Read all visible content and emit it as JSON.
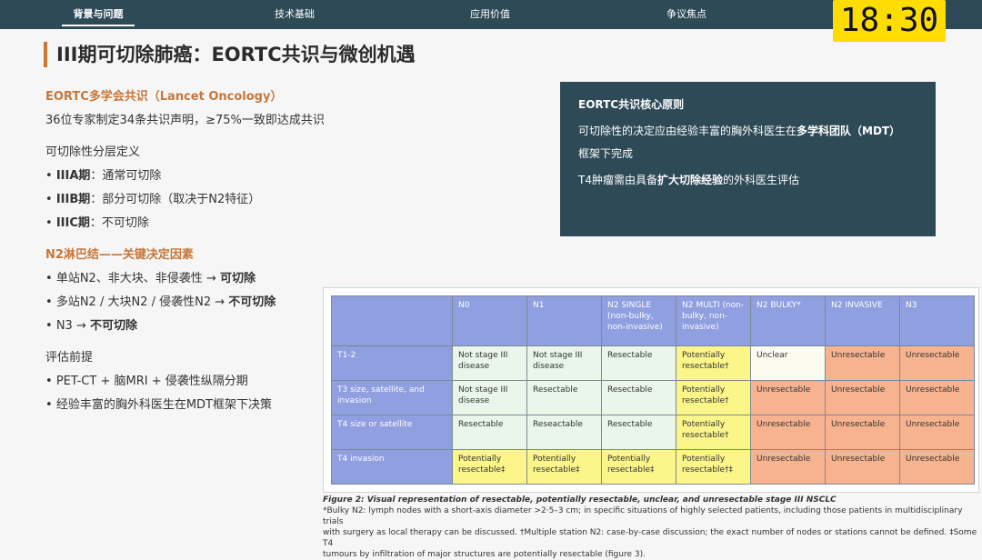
{
  "nav": {
    "tabs": [
      {
        "label": "背景与问题",
        "active": true
      },
      {
        "label": "技术基础"
      },
      {
        "label": "应用价值"
      },
      {
        "label": "争议焦点"
      }
    ]
  },
  "timer": "18:30",
  "slide": {
    "title": "III期可切除肺癌：EORTC共识与微创机遇",
    "eortc_heading": "EORTC多学会共识（Lancet Oncology）",
    "eortc_desc": "36位专家制定34条共识声明，≥75%一致即达成共识",
    "resect_heading": "可切除性分层定义",
    "stages": [
      {
        "label": "IIIA期",
        "desc": "：通常可切除"
      },
      {
        "label": "IIIB期",
        "desc": "：部分可切除（取决于N2特征）"
      },
      {
        "label": "IIIC期",
        "desc": "：不可切除"
      }
    ],
    "n2_heading": "N2淋巴结——关键决定因素",
    "n2_items": [
      {
        "prefix": "单站N2、非大块、非侵袭性 → ",
        "bold": "可切除"
      },
      {
        "prefix": "多站N2 / 大块N2 / 侵袭性N2 → ",
        "bold": "不可切除"
      },
      {
        "prefix": "N3 → ",
        "bold": "不可切除"
      }
    ],
    "eval_heading": "评估前提",
    "eval_items": [
      "PET-CT + 脑MRI + 侵袭性纵隔分期",
      "经验丰富的胸外科医生在MDT框架下决策"
    ]
  },
  "principles": {
    "heading": "EORTC共识核心原则",
    "line1_a": "可切除性的决定应由经验丰富的胸外科医生在",
    "line1_b": "多学科团队（MDT）",
    "line2": "框架下完成",
    "line3_a": "T4肿瘤需由具备",
    "line3_b": "扩大切除经验",
    "line3_c": "的外科医生评估"
  },
  "chart_data": {
    "type": "table",
    "columns": [
      "",
      "N0",
      "N1",
      "N2 SINGLE (non-bulky, non-invasive)",
      "N2 MULTI (non-bulky, non-invasive)",
      "N2 BULKY*",
      "N2 INVASIVE",
      "N3"
    ],
    "rows": [
      {
        "label": "T1-2",
        "cells": [
          "Not stage III disease",
          "Not stage III disease",
          "Resectable",
          "Potentially resectable†",
          "Unclear",
          "Unresectable",
          "Unresectable"
        ]
      },
      {
        "label": "T3 size, satellite, and invasion",
        "cells": [
          "Not stage III disease",
          "Resectable",
          "Resectable",
          "Potentially resectable†",
          "Unresectable",
          "Unresectable",
          "Unresectable"
        ]
      },
      {
        "label": "T4 size or satellite",
        "cells": [
          "Resectable",
          "Reseactable",
          "Resectable",
          "Potentially resectable†",
          "Unresectable",
          "Unresectable",
          "Unresectable"
        ]
      },
      {
        "label": "T4 invasion",
        "cells": [
          "Potentially resectable‡",
          "Potentially resectable‡",
          "Potentially resectable‡",
          "Potentially resectable†‡",
          "Unresectable",
          "Unresectable",
          "Unresectable"
        ]
      }
    ],
    "colors": {
      "header": "#8f9fe0",
      "resectable": "#e9f6e9",
      "potential": "#fbf58a",
      "unclear": "#fcfbf0",
      "unresectable": "#f7b38f"
    }
  },
  "caption": {
    "title": "Figure 2: Visual representation of resectable, potentially resectable, unclear, and unresectable stage III NSCLC",
    "line1": "*Bulky N2: lymph nodes with a short-axis diameter >2·5–3 cm; in specific situations of highly selected patients, including those patients in multidisciplinary trials",
    "line2": "with surgery as local therapy can be discussed. †Multiple station N2: case-by-case discussion; the exact number of nodes or stations cannot be defined. ‡Some T4",
    "line3": "tumours by infiltration of major structures are potentially resectable (figure 3)."
  }
}
